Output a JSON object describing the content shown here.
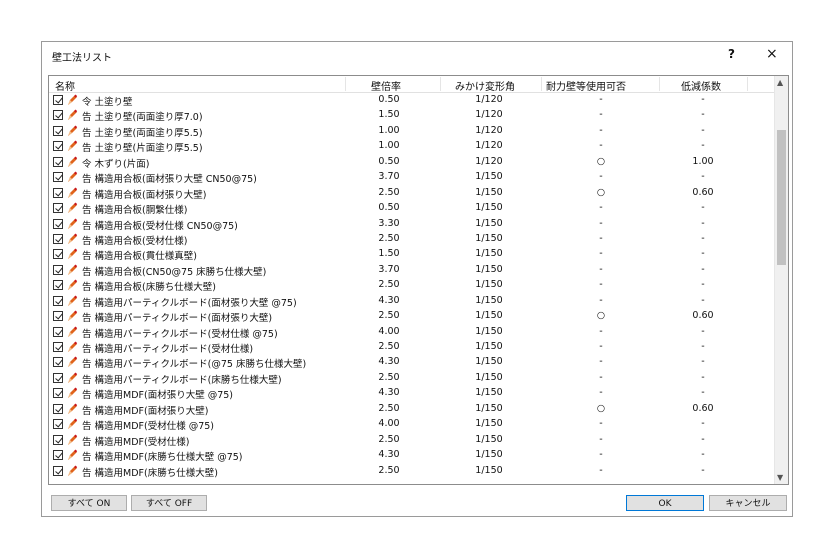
{
  "window": {
    "title": "壁工法リスト",
    "help_label": "?",
    "close_label": "×"
  },
  "columns": [
    "名称",
    "壁倍率",
    "みかけ変形角",
    "耐力壁等使用可否",
    "低減係数"
  ],
  "rows": [
    {
      "name": "令 土塗り壁",
      "ratio": "0.50",
      "angle": "1/120",
      "usable": "-",
      "factor": "-"
    },
    {
      "name": "告 土塗り壁(両面塗り厚7.0)",
      "ratio": "1.50",
      "angle": "1/120",
      "usable": "-",
      "factor": "-"
    },
    {
      "name": "告 土塗り壁(両面塗り厚5.5)",
      "ratio": "1.00",
      "angle": "1/120",
      "usable": "-",
      "factor": "-"
    },
    {
      "name": "告 土塗り壁(片面塗り厚5.5)",
      "ratio": "1.00",
      "angle": "1/120",
      "usable": "-",
      "factor": "-"
    },
    {
      "name": "令 木ずり(片面)",
      "ratio": "0.50",
      "angle": "1/120",
      "usable": "○",
      "factor": "1.00"
    },
    {
      "name": "告 構造用合板(面材張り大壁 CN50@75)",
      "ratio": "3.70",
      "angle": "1/150",
      "usable": "-",
      "factor": "-"
    },
    {
      "name": "告 構造用合板(面材張り大壁)",
      "ratio": "2.50",
      "angle": "1/150",
      "usable": "○",
      "factor": "0.60"
    },
    {
      "name": "告 構造用合板(胴繋仕様)",
      "ratio": "0.50",
      "angle": "1/150",
      "usable": "-",
      "factor": "-"
    },
    {
      "name": "告 構造用合板(受材仕様 CN50@75)",
      "ratio": "3.30",
      "angle": "1/150",
      "usable": "-",
      "factor": "-"
    },
    {
      "name": "告 構造用合板(受材仕様)",
      "ratio": "2.50",
      "angle": "1/150",
      "usable": "-",
      "factor": "-"
    },
    {
      "name": "告 構造用合板(貫仕様真壁)",
      "ratio": "1.50",
      "angle": "1/150",
      "usable": "-",
      "factor": "-"
    },
    {
      "name": "告 構造用合板(CN50@75 床勝ち仕様大壁)",
      "ratio": "3.70",
      "angle": "1/150",
      "usable": "-",
      "factor": "-"
    },
    {
      "name": "告 構造用合板(床勝ち仕様大壁)",
      "ratio": "2.50",
      "angle": "1/150",
      "usable": "-",
      "factor": "-"
    },
    {
      "name": "告 構造用パーティクルボード(面材張り大壁 @75)",
      "ratio": "4.30",
      "angle": "1/150",
      "usable": "-",
      "factor": "-"
    },
    {
      "name": "告 構造用パーティクルボード(面材張り大壁)",
      "ratio": "2.50",
      "angle": "1/150",
      "usable": "○",
      "factor": "0.60"
    },
    {
      "name": "告 構造用パーティクルボード(受材仕様 @75)",
      "ratio": "4.00",
      "angle": "1/150",
      "usable": "-",
      "factor": "-"
    },
    {
      "name": "告 構造用パーティクルボード(受材仕様)",
      "ratio": "2.50",
      "angle": "1/150",
      "usable": "-",
      "factor": "-"
    },
    {
      "name": "告 構造用パーティクルボード(@75 床勝ち仕様大壁)",
      "ratio": "4.30",
      "angle": "1/150",
      "usable": "-",
      "factor": "-"
    },
    {
      "name": "告 構造用パーティクルボード(床勝ち仕様大壁)",
      "ratio": "2.50",
      "angle": "1/150",
      "usable": "-",
      "factor": "-"
    },
    {
      "name": "告 構造用MDF(面材張り大壁 @75)",
      "ratio": "4.30",
      "angle": "1/150",
      "usable": "-",
      "factor": "-"
    },
    {
      "name": "告 構造用MDF(面材張り大壁)",
      "ratio": "2.50",
      "angle": "1/150",
      "usable": "○",
      "factor": "0.60"
    },
    {
      "name": "告 構造用MDF(受材仕様 @75)",
      "ratio": "4.00",
      "angle": "1/150",
      "usable": "-",
      "factor": "-"
    },
    {
      "name": "告 構造用MDF(受材仕様)",
      "ratio": "2.50",
      "angle": "1/150",
      "usable": "-",
      "factor": "-"
    },
    {
      "name": "告 構造用MDF(床勝ち仕様大壁 @75)",
      "ratio": "4.30",
      "angle": "1/150",
      "usable": "-",
      "factor": "-"
    },
    {
      "name": "告 構造用MDF(床勝ち仕様大壁)",
      "ratio": "2.50",
      "angle": "1/150",
      "usable": "-",
      "factor": "-"
    }
  ],
  "buttons": {
    "all_on": "すべて ON",
    "all_off": "すべて OFF",
    "ok": "OK",
    "cancel": "キャンセル"
  },
  "icons": {
    "row_icon": "wall-pencil-icon",
    "check": "checkbox-checked-icon"
  },
  "colors": {
    "accent": "#0078d7",
    "icon_orange": "#e0641c",
    "icon_red": "#c8161e"
  }
}
